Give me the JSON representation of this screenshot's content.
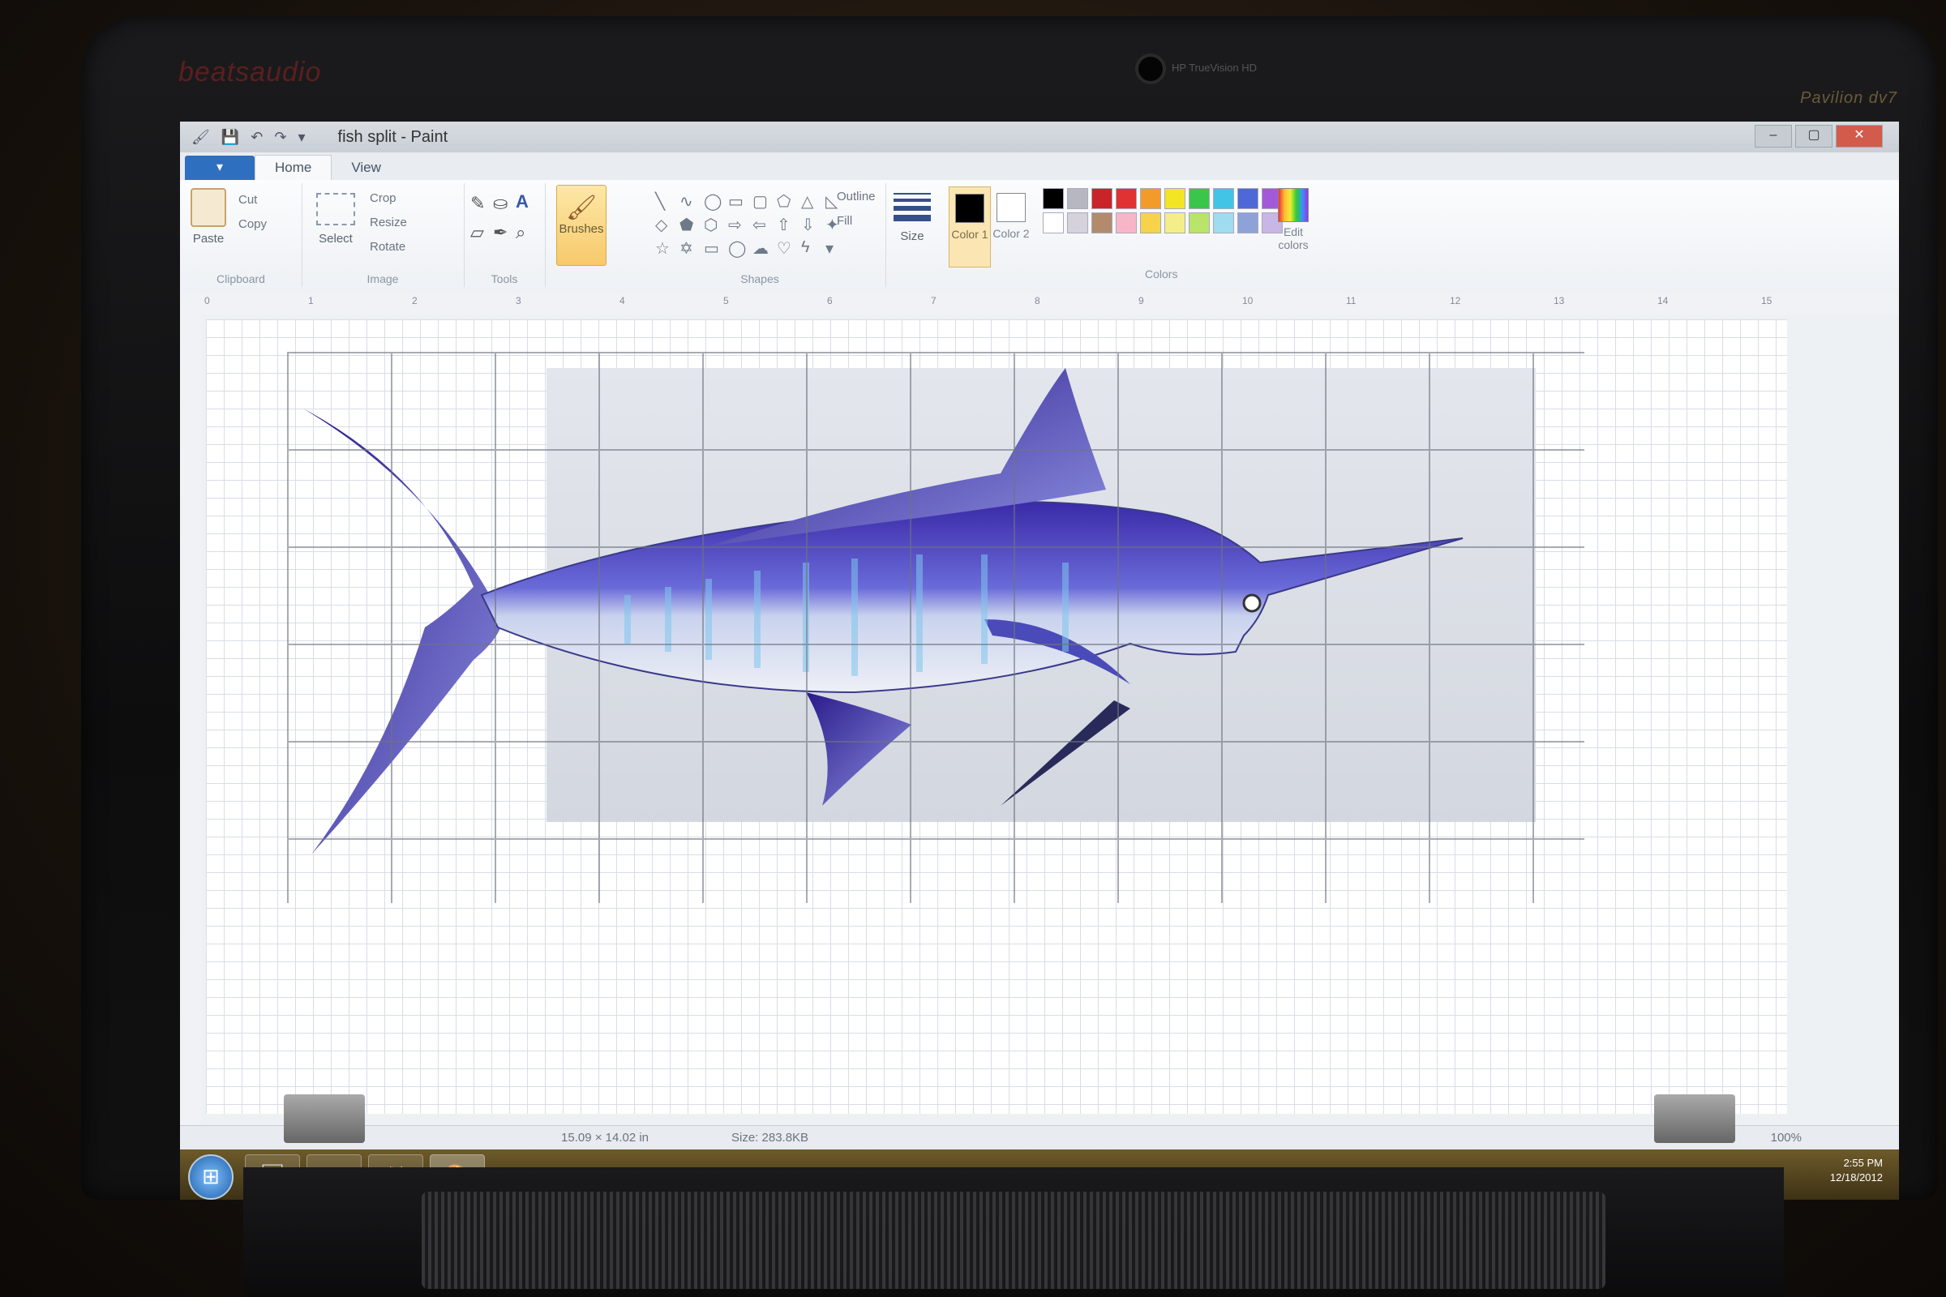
{
  "laptop": {
    "brand_left": "beatsaudio",
    "webcam_label": "HP TrueVision HD",
    "model": "Pavilion dv7"
  },
  "window": {
    "title": "fish split - Paint",
    "controls": [
      "–",
      "▢",
      "✕"
    ]
  },
  "tabs": {
    "menu_icon": "▾",
    "items": [
      "Home",
      "View"
    ]
  },
  "ribbon": {
    "clipboard": {
      "label": "Clipboard",
      "paste": "Paste",
      "cut": "Cut",
      "copy": "Copy"
    },
    "image": {
      "label": "Image",
      "select": "Select",
      "crop": "Crop",
      "resize": "Resize",
      "rotate": "Rotate"
    },
    "tools": {
      "label": "Tools",
      "text_tool": "A"
    },
    "brushes": "Brushes",
    "shapes": {
      "label": "Shapes",
      "outline": "Outline",
      "fill": "Fill"
    },
    "size": "Size",
    "color1": "Color 1",
    "color2": "Color 2",
    "colors_label": "Colors",
    "edit_colors": "Edit colors",
    "palette": [
      "#000000",
      "#b7b7c2",
      "#c8242a",
      "#e03232",
      "#f39b2a",
      "#f2e524",
      "#3ac54b",
      "#42c4e6",
      "#4f68d8",
      "#a35ad8",
      "#ffffff",
      "#d5d2dc",
      "#b38a6c",
      "#f7b6c8",
      "#f6d34a",
      "#f4ee8a",
      "#b9e36a",
      "#9fdcf0",
      "#8ea2d8",
      "#c7b6e6"
    ]
  },
  "rulers": {
    "top_ticks": [
      "0",
      "1",
      "2",
      "3",
      "4",
      "5",
      "6",
      "7",
      "8",
      "9",
      "10",
      "11",
      "12",
      "13",
      "14",
      "15"
    ]
  },
  "status": {
    "dimensions": "15.09 × 14.02 in",
    "size": "Size: 283.8KB",
    "zoom": "100%"
  },
  "taskbar": {
    "start_icon": "windows-orb",
    "apps": [
      "paint",
      "media-player",
      "firefox",
      "paint-active"
    ],
    "time": "2:55 PM",
    "date": "12/18/2012"
  }
}
